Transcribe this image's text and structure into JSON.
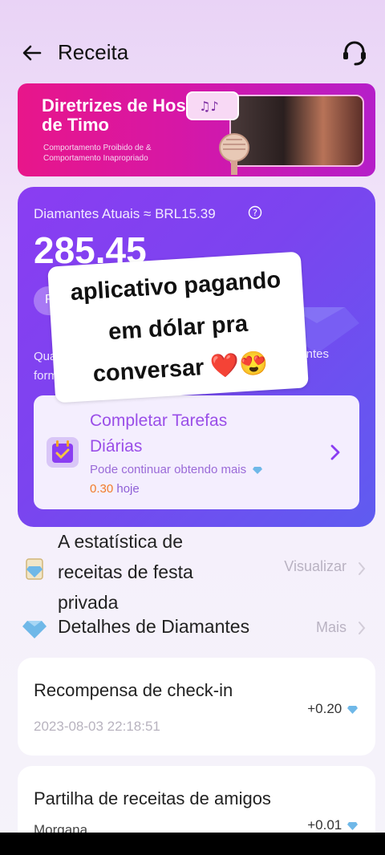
{
  "header": {
    "title": "Receita",
    "back_icon": "arrow-left-icon",
    "support_icon": "headset-icon"
  },
  "banner": {
    "title": "Diretrizes de Host de Timo",
    "subtitle": "Comportamento Proibido de & Comportamento Inapropriado"
  },
  "wallet": {
    "label": "Diamantes Atuais ≈ BRL15.39",
    "value": "285.45",
    "withdraw_label": "R",
    "desc_left_1": "Quanti",
    "desc_left_2": "formas",
    "desc_right": "uintes"
  },
  "task": {
    "title": "Completar Tarefas Diárias",
    "subtitle": "Pode continuar obtendo mais",
    "today_amount": "0.30",
    "today_suffix": "hoje"
  },
  "sticker": {
    "line1": "aplicativo pagando",
    "line2": "em dólar pra",
    "line3": "conversar ❤️😍"
  },
  "rows": {
    "stats_label": "A estatística de receitas de festa privada",
    "stats_action": "Visualizar",
    "details_label": "Detalhes de Diamantes",
    "details_action": "Mais"
  },
  "records": [
    {
      "title": "Recompensa de check-in",
      "date": "2023-08-03 22:18:51",
      "amount": "+0.20"
    },
    {
      "title": "Partilha de receitas de amigos",
      "date": "Morgana",
      "amount": "+0.01"
    }
  ],
  "colors": {
    "card_start": "#8a3df2",
    "card_end": "#5f5cf0",
    "accent": "#9a4ee8",
    "today": "#f27b2a"
  }
}
